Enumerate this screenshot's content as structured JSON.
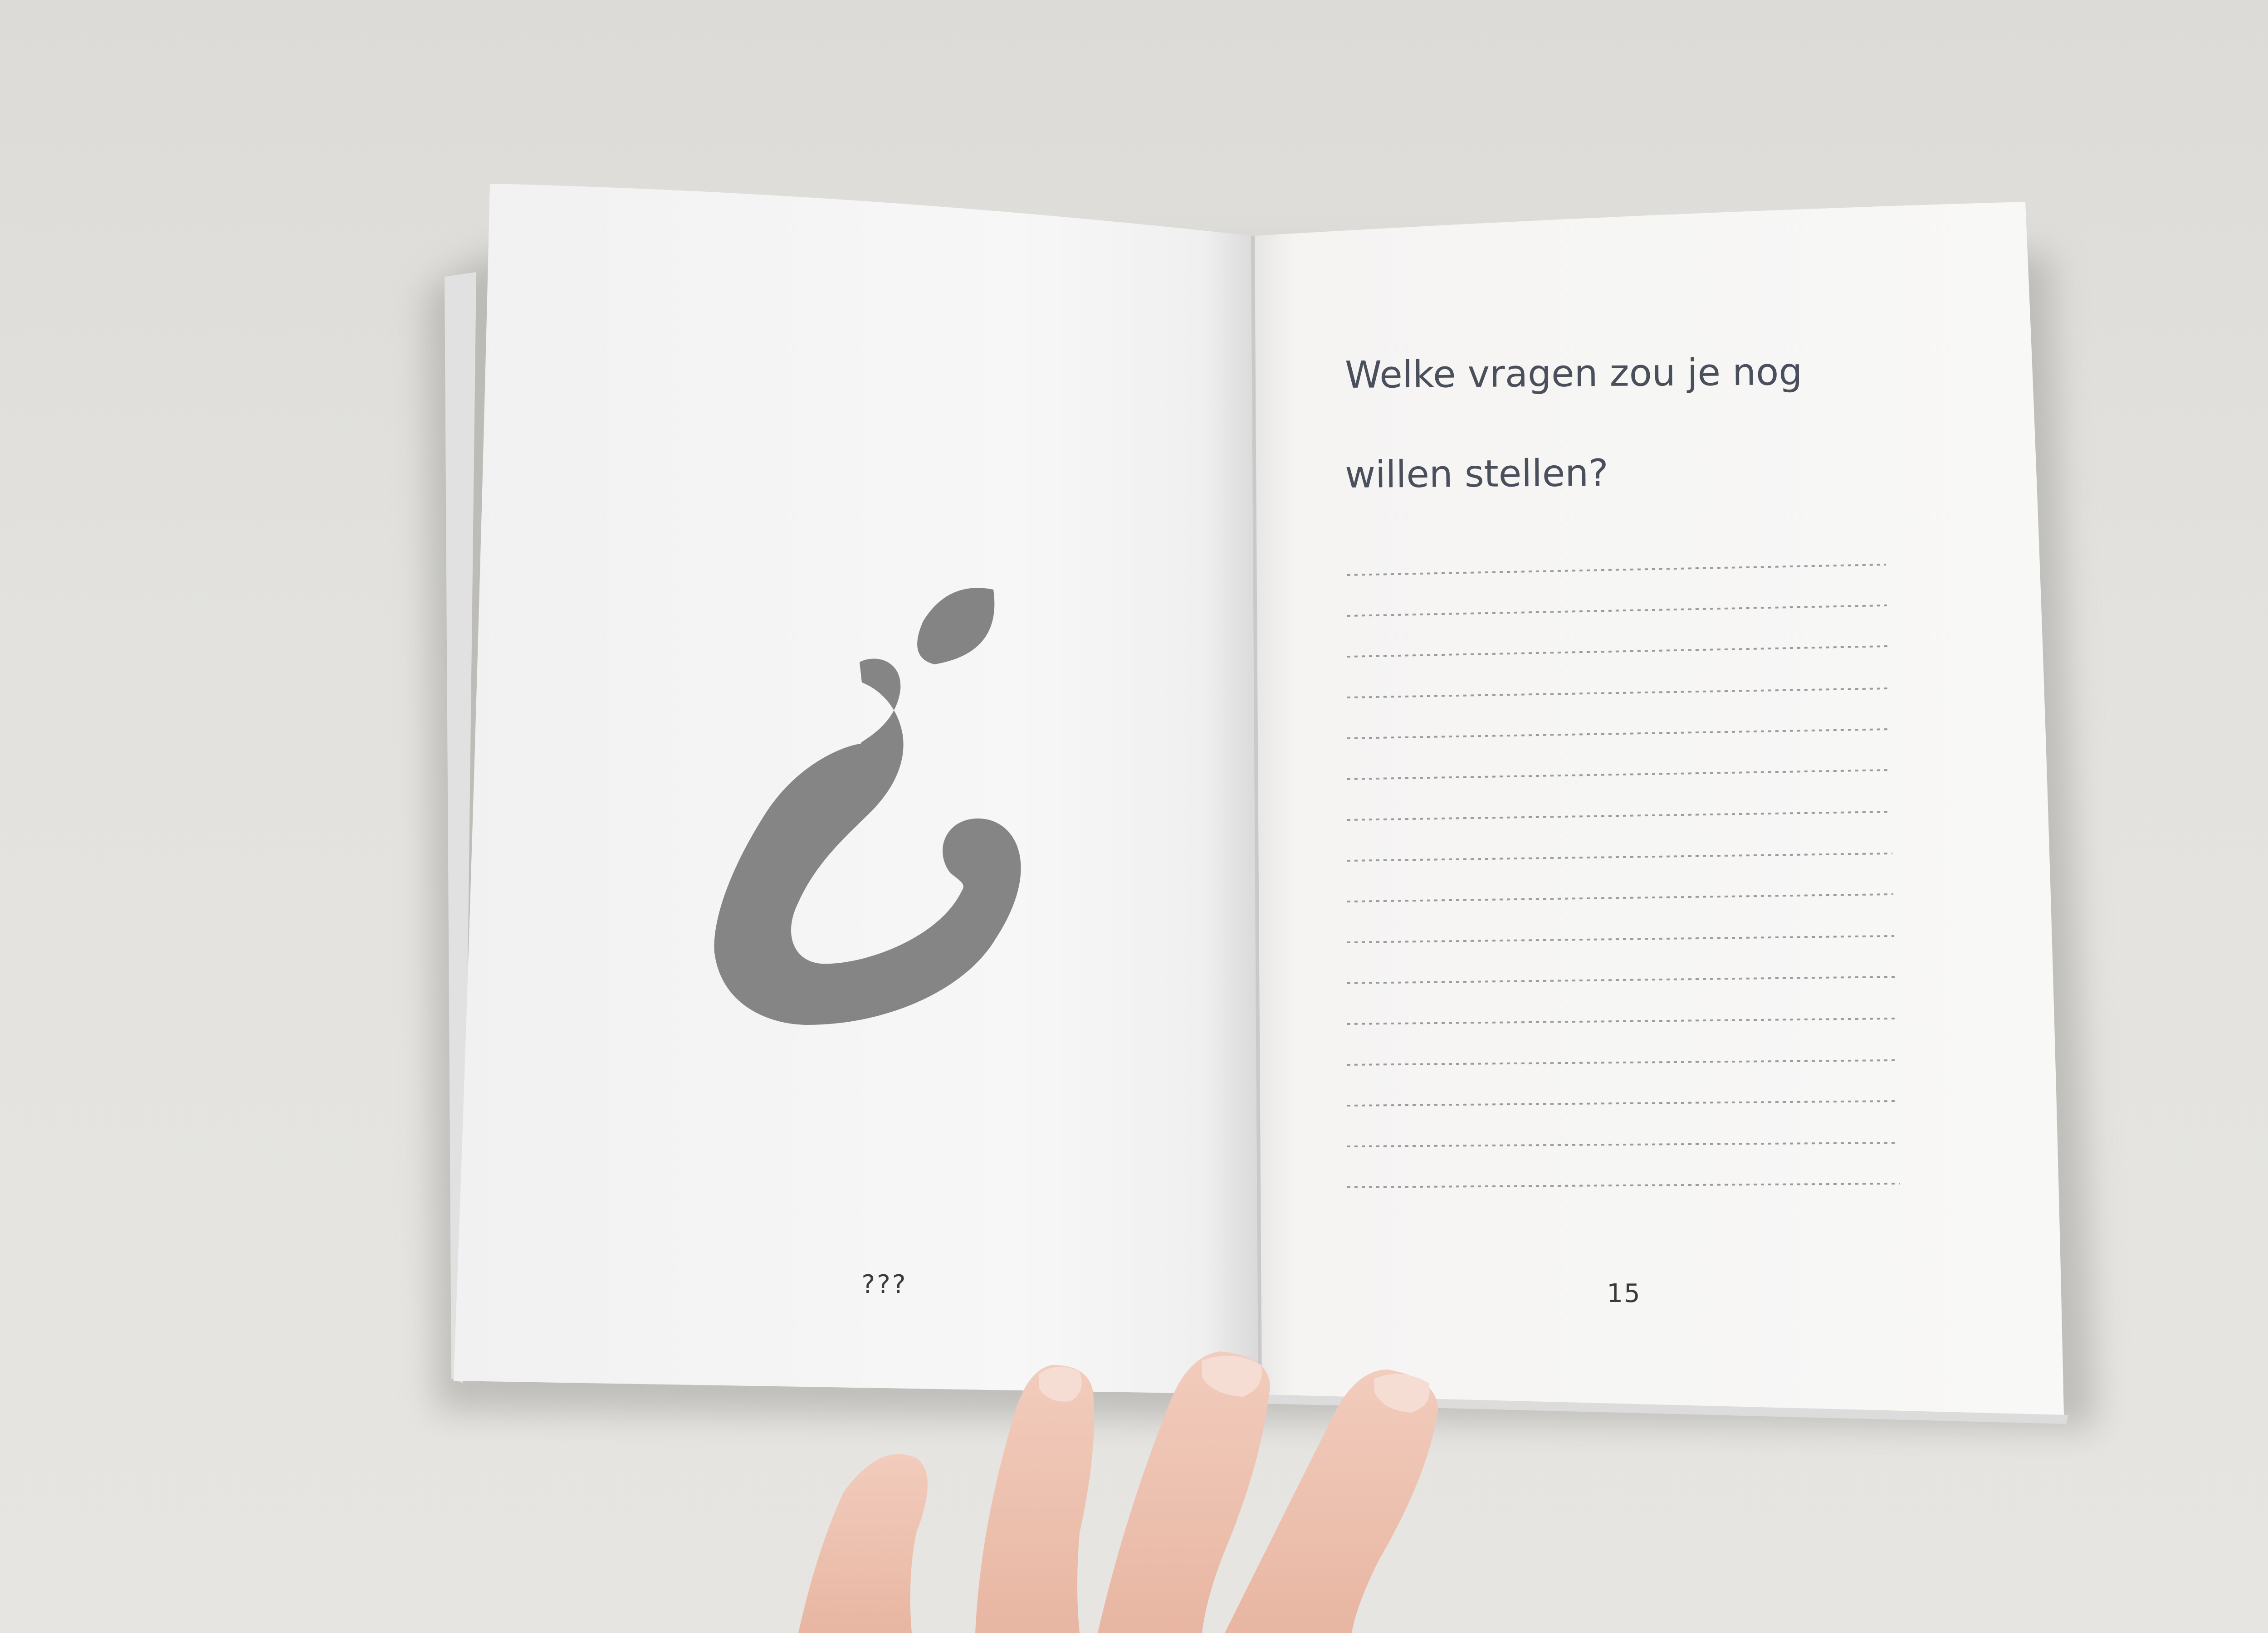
{
  "left_page": {
    "page_number": "???"
  },
  "right_page": {
    "question_lines": [
      "Welke vragen zou je nog",
      "willen stellen?"
    ],
    "page_number": "15"
  }
}
